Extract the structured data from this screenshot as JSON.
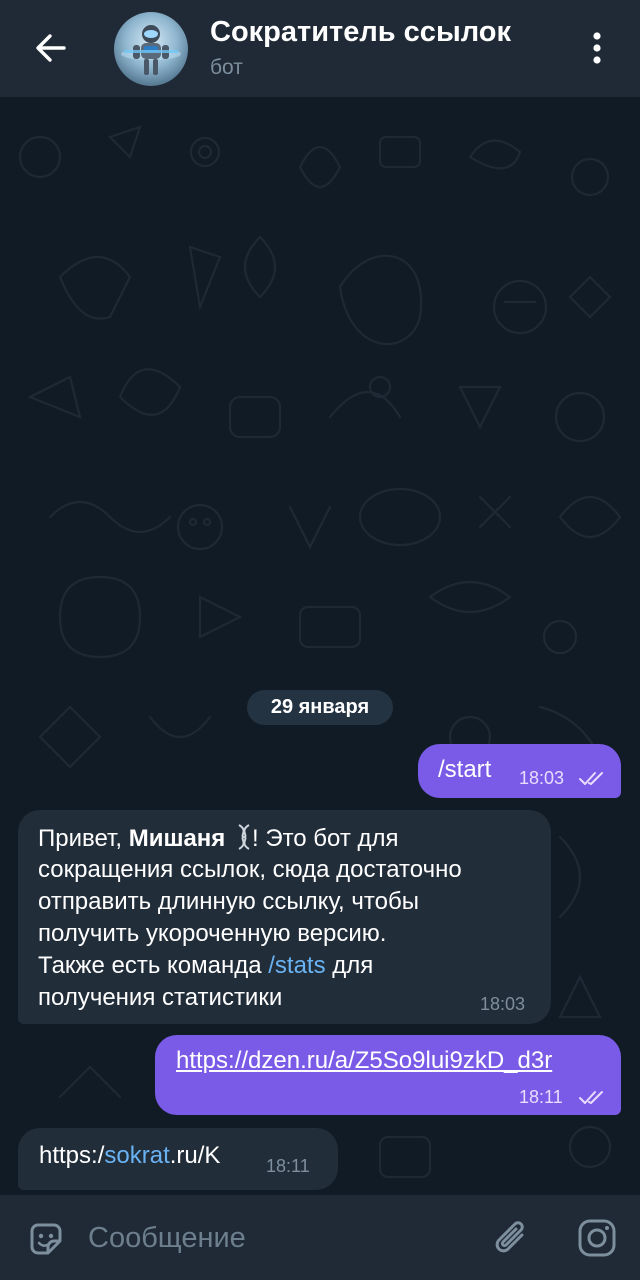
{
  "header": {
    "title": "Сократитель ссылок",
    "subtitle": "бот",
    "back_icon": "arrow-left-icon",
    "menu_icon": "more-vertical-icon"
  },
  "chat": {
    "date_separator": "29 января",
    "messages": [
      {
        "direction": "outgoing",
        "text": "/start",
        "time": "18:03",
        "status": "read"
      },
      {
        "direction": "incoming",
        "lines": [
          {
            "before": "Привет, ",
            "bold": "Мишаня",
            "emoji": "DNA emoji",
            "after": "! Это бот для"
          },
          {
            "text": "сокращения ссылок, сюда достаточно"
          },
          {
            "text": "отправить длинную ссылку, чтобы"
          },
          {
            "text": "получить укороченную версию."
          },
          {
            "before": "Также есть команда ",
            "command": "/stats",
            "after": " для"
          },
          {
            "text": "получения статистики"
          }
        ],
        "time": "18:03"
      },
      {
        "direction": "outgoing",
        "link": "https://dzen.ru/a/Z5So9lui9zkD_d3r",
        "time": "18:11",
        "status": "read"
      },
      {
        "direction": "incoming",
        "before": "https:/",
        "link_part": "sokrat",
        "after": ".ru/K",
        "time": "18:11"
      }
    ]
  },
  "composer": {
    "placeholder": "Сообщение",
    "emoji_icon": "sticker-emoji-icon",
    "attach_icon": "paperclip-icon",
    "camera_icon": "instagram-camera-icon"
  },
  "colors": {
    "header_bg": "#1f2a36",
    "chat_bg": "#111b25",
    "outgoing_bubble": "#7a5be8",
    "incoming_bubble": "#222d3a",
    "link": "#6ab3f3"
  }
}
